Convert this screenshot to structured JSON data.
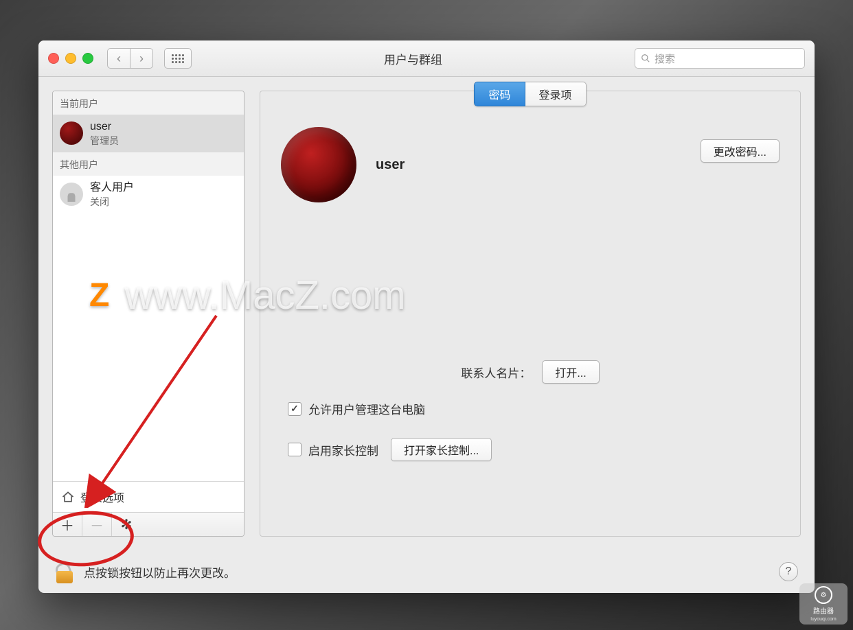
{
  "window": {
    "title": "用户与群组",
    "search_placeholder": "搜索"
  },
  "sidebar": {
    "current_user_header": "当前用户",
    "other_users_header": "其他用户",
    "current": {
      "name": "user",
      "role": "管理员"
    },
    "guest": {
      "name": "客人用户",
      "status": "关闭"
    },
    "login_options_label": "登录选项"
  },
  "tabs": {
    "password": "密码",
    "login_items": "登录项"
  },
  "profile": {
    "name": "user",
    "change_password_btn": "更改密码..."
  },
  "contact": {
    "label": "联系人名片：",
    "open_btn": "打开..."
  },
  "checkboxes": {
    "allow_admin": "允许用户管理这台电脑",
    "parental": "启用家长控制",
    "parental_open_btn": "打开家长控制..."
  },
  "footer": {
    "lock_text": "点按锁按钮以防止再次更改。"
  },
  "watermark": {
    "z": "Z",
    "url": "www.MacZ.com"
  },
  "corner": {
    "label": "路由器",
    "sub": "luyouqi.com"
  }
}
